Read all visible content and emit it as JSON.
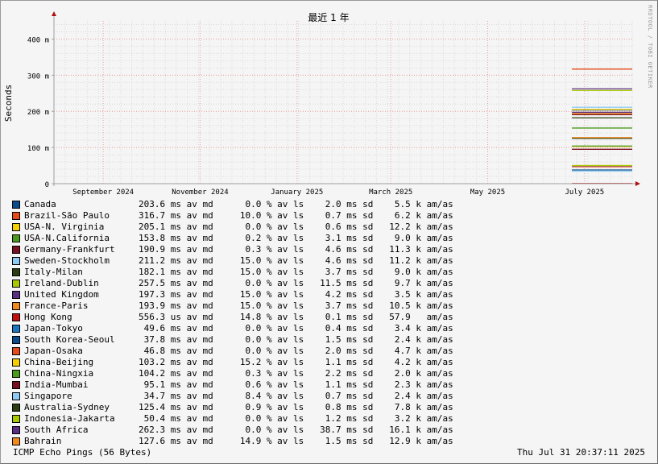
{
  "chart_data": {
    "type": "line",
    "title": "最近 1 年",
    "ylabel": "Seconds",
    "xlabel": "",
    "ylim": [
      0,
      0.45
    ],
    "ytick_values": [
      0,
      0.1,
      0.2,
      0.3,
      0.4
    ],
    "ytick_labels": [
      "0",
      "100 m",
      "200 m",
      "300 m",
      "400 m"
    ],
    "x_range": [
      "2024-08-01",
      "2025-08-01"
    ],
    "xtick_labels": [
      {
        "label": "September 2024",
        "date": "2024-09-01"
      },
      {
        "label": "November 2024",
        "date": "2024-11-01"
      },
      {
        "label": "January 2025",
        "date": "2025-01-01"
      },
      {
        "label": "March 2025",
        "date": "2025-03-01"
      },
      {
        "label": "May 2025",
        "date": "2025-05-01"
      },
      {
        "label": "July 2025",
        "date": "2025-07-01"
      }
    ],
    "data_start": "2025-06-23",
    "grid": true,
    "series": [
      {
        "name": "Canada",
        "color": "#0a4d8c",
        "value": 0.2036,
        "stats": "203.6 ms av md      0.0 % av ls    2.0 ms sd    5.5 k am/as"
      },
      {
        "name": "Brazil-São Paulo",
        "color": "#e64a19",
        "value": 0.3167,
        "stats": "316.7 ms av md     10.0 % av ls    0.7 ms sd    6.2 k am/as"
      },
      {
        "name": "USA-N. Virginia",
        "color": "#f5d000",
        "value": 0.2051,
        "stats": "205.1 ms av md      0.0 % av ls    0.6 ms sd   12.2 k am/as"
      },
      {
        "name": "USA-N.California",
        "color": "#4a9a1c",
        "value": 0.1538,
        "stats": "153.8 ms av md      0.2 % av ls    3.1 ms sd    9.0 k am/as"
      },
      {
        "name": "Germany-Frankfurt",
        "color": "#7a0f1f",
        "value": 0.1909,
        "stats": "190.9 ms av md      0.3 % av ls    4.6 ms sd   11.3 k am/as"
      },
      {
        "name": "Sweden-Stockholm",
        "color": "#8ecbf2",
        "value": 0.2112,
        "stats": "211.2 ms av md     15.0 % av ls    4.6 ms sd   11.2 k am/as"
      },
      {
        "name": "Italy-Milan",
        "color": "#2c3d14",
        "value": 0.1821,
        "stats": "182.1 ms av md     15.0 % av ls    3.7 ms sd    9.0 k am/as"
      },
      {
        "name": "Ireland-Dublin",
        "color": "#a8c800",
        "value": 0.2575,
        "stats": "257.5 ms av md      0.0 % av ls   11.5 ms sd    9.7 k am/as"
      },
      {
        "name": "United Kingdom",
        "color": "#5a2d82",
        "value": 0.1973,
        "stats": "197.3 ms av md     15.0 % av ls    4.2 ms sd    3.5 k am/as"
      },
      {
        "name": "France-Paris",
        "color": "#f08a1c",
        "value": 0.1939,
        "stats": "193.9 ms av md     15.0 % av ls    3.7 ms sd   10.5 k am/as"
      },
      {
        "name": "Hong Kong",
        "color": "#c01010",
        "value": 0.0005563,
        "stats": "556.3 us av md     14.8 % av ls    0.1 ms sd   57.9   am/as"
      },
      {
        "name": "Japan-Tokyo",
        "color": "#1a78c2",
        "value": 0.0496,
        "stats": " 49.6 ms av md      0.0 % av ls    0.4 ms sd    3.4 k am/as"
      },
      {
        "name": "South Korea-Seoul",
        "color": "#0a4d8c",
        "value": 0.0378,
        "stats": " 37.8 ms av md      0.0 % av ls    1.5 ms sd    2.4 k am/as"
      },
      {
        "name": "Japan-Osaka",
        "color": "#e64a19",
        "value": 0.0468,
        "stats": " 46.8 ms av md      0.0 % av ls    2.0 ms sd    4.7 k am/as"
      },
      {
        "name": "China-Beijing",
        "color": "#f5d000",
        "value": 0.1032,
        "stats": "103.2 ms av md     15.2 % av ls    1.1 ms sd    4.2 k am/as"
      },
      {
        "name": "China-Ningxia",
        "color": "#4a9a1c",
        "value": 0.1042,
        "stats": "104.2 ms av md      0.3 % av ls    2.2 ms sd    2.0 k am/as"
      },
      {
        "name": "India-Mumbai",
        "color": "#7a0f1f",
        "value": 0.0951,
        "stats": " 95.1 ms av md      0.6 % av ls    1.1 ms sd    2.3 k am/as"
      },
      {
        "name": "Singapore",
        "color": "#8ecbf2",
        "value": 0.0347,
        "stats": " 34.7 ms av md      8.4 % av ls    0.7 ms sd    2.4 k am/as"
      },
      {
        "name": "Australia-Sydney",
        "color": "#2c3d14",
        "value": 0.1254,
        "stats": "125.4 ms av md      0.9 % av ls    0.8 ms sd    7.8 k am/as"
      },
      {
        "name": "Indonesia-Jakarta",
        "color": "#a8c800",
        "value": 0.0504,
        "stats": " 50.4 ms av md      0.0 % av ls    1.2 ms sd    3.2 k am/as"
      },
      {
        "name": "South Africa",
        "color": "#5a2d82",
        "value": 0.2623,
        "stats": "262.3 ms av md      0.0 % av ls   38.7 ms sd   16.1 k am/as"
      },
      {
        "name": "Bahrain",
        "color": "#f08a1c",
        "value": 0.1276,
        "stats": "127.6 ms av md     14.9 % av ls    1.5 ms sd   12.9 k am/as"
      }
    ]
  },
  "footer": {
    "left": "ICMP Echo Pings (56 Bytes)",
    "right": "Thu Jul 31 20:37:11 2025"
  },
  "watermark": "RRDTOOL / TOBI OETIKER"
}
